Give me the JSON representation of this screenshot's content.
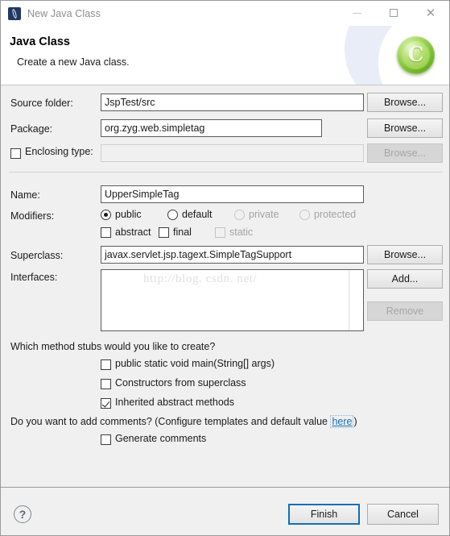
{
  "window": {
    "title": "New Java Class",
    "app_icon": "eclipse-java-icon",
    "controls": {
      "minimize": "minimize-icon",
      "maximize": "maximize-icon",
      "close": "close-icon"
    }
  },
  "header": {
    "title": "Java Class",
    "subtitle": "Create a new Java class.",
    "icon_letter": "C",
    "icon_name": "java-class-wizard-icon"
  },
  "form": {
    "source_folder": {
      "label": "Source folder:",
      "value": "JspTest/src",
      "button": "Browse..."
    },
    "package": {
      "label": "Package:",
      "value": "org.zyg.web.simpletag",
      "button": "Browse..."
    },
    "enclosing_type": {
      "label": "Enclosing type:",
      "checked": false,
      "value": "",
      "button": "Browse...",
      "enabled": false
    },
    "name": {
      "label": "Name:",
      "value": "UpperSimpleTag"
    },
    "modifiers": {
      "label": "Modifiers:",
      "access": [
        {
          "label": "public",
          "selected": true,
          "enabled": true
        },
        {
          "label": "default",
          "selected": false,
          "enabled": true
        },
        {
          "label": "private",
          "selected": false,
          "enabled": false
        },
        {
          "label": "protected",
          "selected": false,
          "enabled": false
        }
      ],
      "flags": [
        {
          "label": "abstract",
          "checked": false,
          "enabled": true
        },
        {
          "label": "final",
          "checked": false,
          "enabled": true
        },
        {
          "label": "static",
          "checked": false,
          "enabled": false
        }
      ]
    },
    "superclass": {
      "label": "Superclass:",
      "value": "javax.servlet.jsp.tagext.SimpleTagSupport",
      "button": "Browse..."
    },
    "interfaces": {
      "label": "Interfaces:",
      "items": [],
      "watermark": "http://blog. csdn. net/",
      "add_button": "Add...",
      "remove_button": "Remove",
      "remove_enabled": false
    },
    "stubs": {
      "question": "Which method stubs would you like to create?",
      "options": [
        {
          "label": "public static void main(String[] args)",
          "checked": false
        },
        {
          "label": "Constructors from superclass",
          "checked": false
        },
        {
          "label": "Inherited abstract methods",
          "checked": true
        }
      ]
    },
    "comments": {
      "question_prefix": "Do you want to add comments? (Configure templates and default value ",
      "link": "here",
      "question_suffix": ")",
      "option": {
        "label": "Generate comments",
        "checked": false
      }
    }
  },
  "footer": {
    "help_icon": "help-icon",
    "help_glyph": "?",
    "finish": "Finish",
    "cancel": "Cancel"
  },
  "colors": {
    "dialog_bg": "#f0f0f0",
    "accent_blue": "#0e6fba",
    "link_blue": "#1a6fb5",
    "icon_green": "#8cc63f",
    "disabled_text": "#a3a3a3"
  }
}
